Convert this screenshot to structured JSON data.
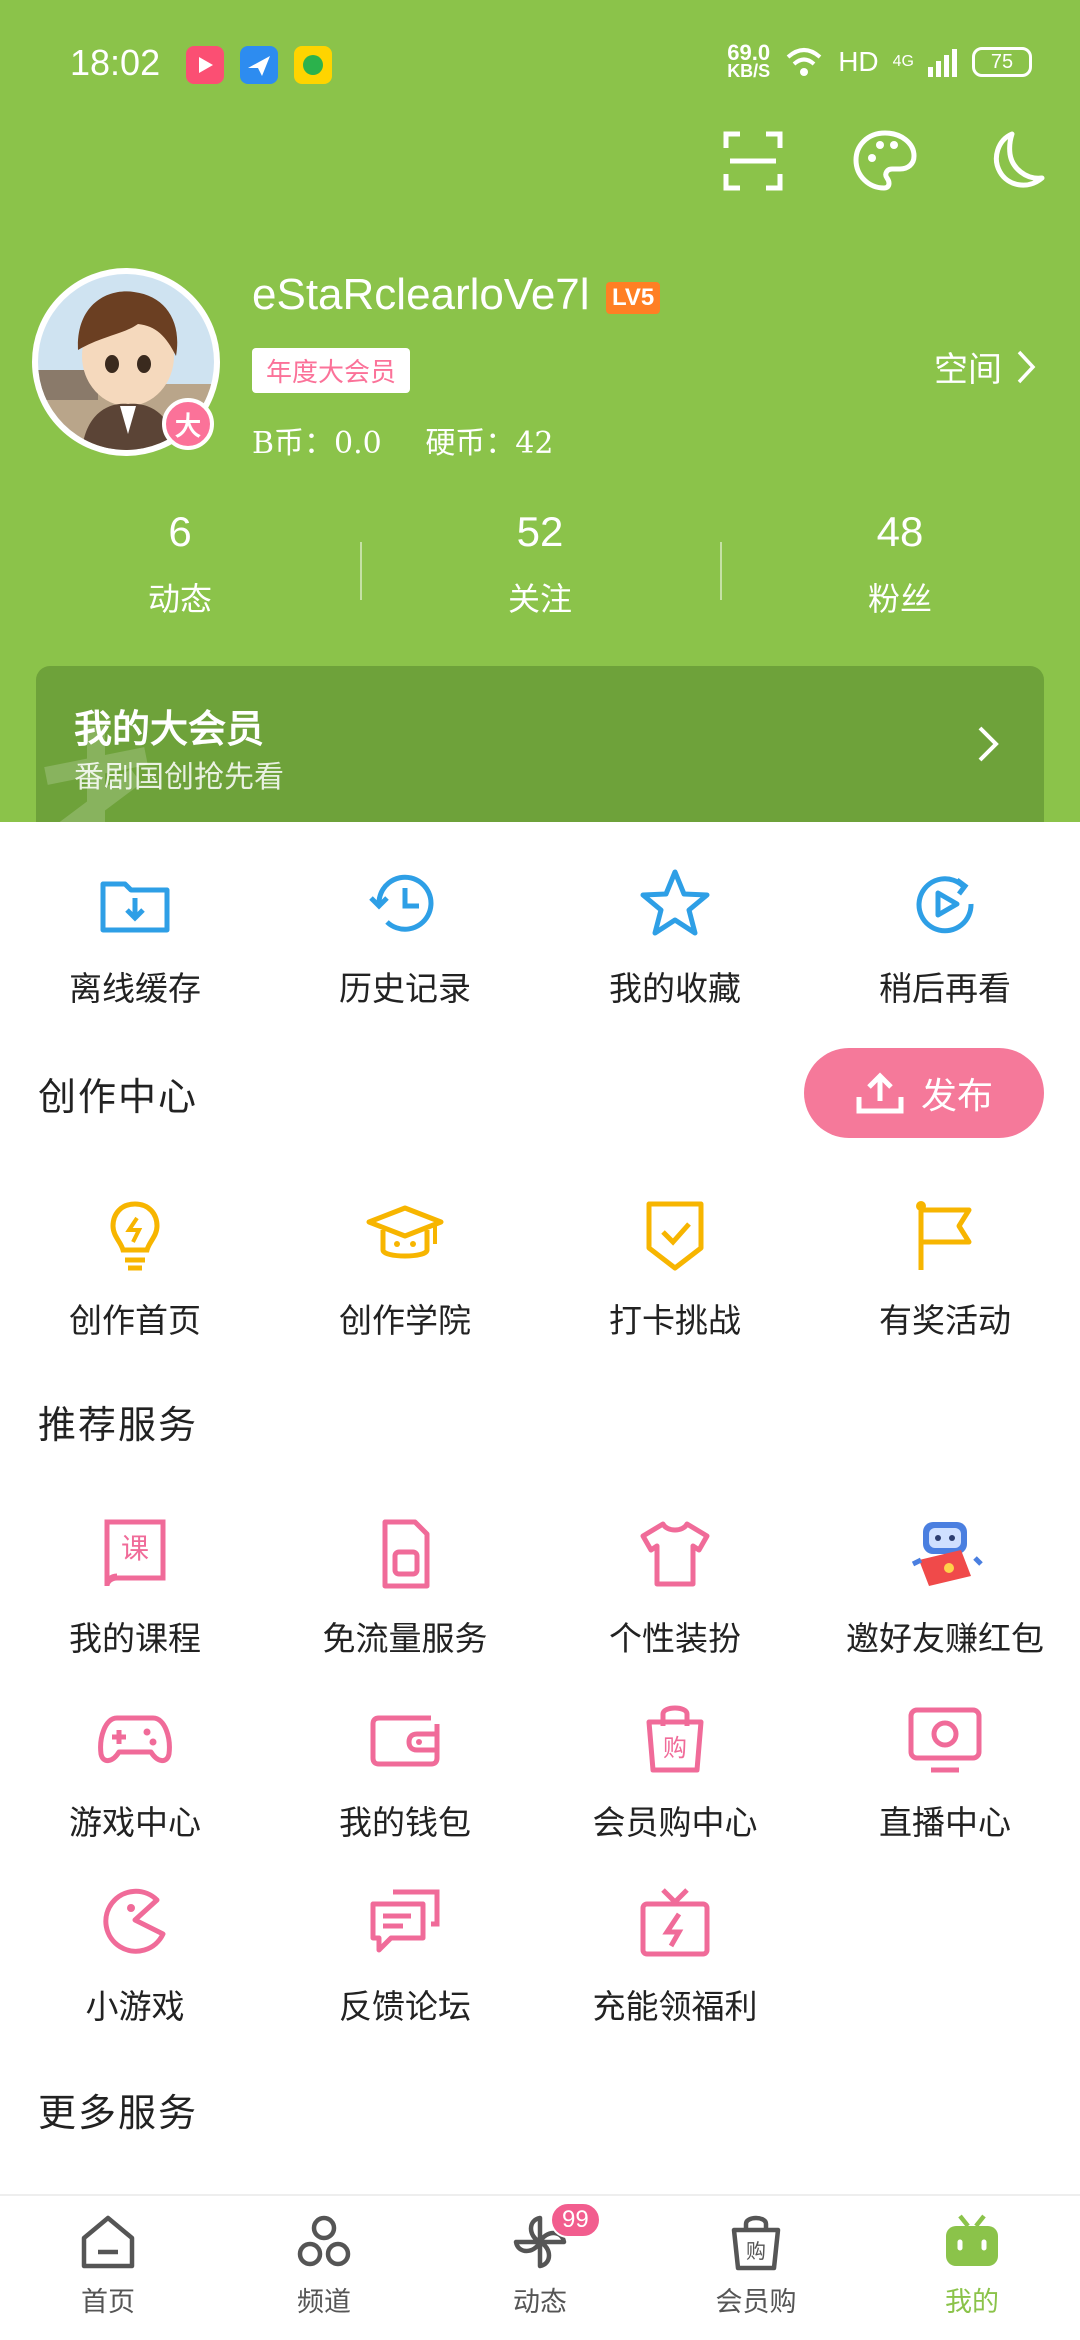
{
  "colors": {
    "header_bg": "#8bc34a",
    "pink": "#fb7299",
    "blue_icon": "#2e9fe6",
    "yellow_icon": "#f7b500",
    "pink_icon": "#f06b99"
  },
  "status_bar": {
    "time": "18:02",
    "net_speed": "69.0",
    "net_unit": "KB/S",
    "hd": "HD",
    "signal": "4G",
    "battery": "75"
  },
  "profile": {
    "username": "eStaRclearloVe7l",
    "level": "LV5",
    "vip_tag": "年度大会员",
    "vip_dot": "大",
    "b_coin": "B币：0.0",
    "coin": "硬币：42",
    "space_label": "空间"
  },
  "stats": [
    {
      "num": "6",
      "label": "动态"
    },
    {
      "num": "52",
      "label": "关注"
    },
    {
      "num": "48",
      "label": "粉丝"
    }
  ],
  "vip_card": {
    "title": "我的大会员",
    "subtitle": "番剧国创抢先看"
  },
  "quick": [
    {
      "label": "离线缓存",
      "icon": "download-folder-icon"
    },
    {
      "label": "历史记录",
      "icon": "history-clock-icon"
    },
    {
      "label": "我的收藏",
      "icon": "star-icon"
    },
    {
      "label": "稍后再看",
      "icon": "watch-later-icon"
    }
  ],
  "creation": {
    "title": "创作中心",
    "publish": "发布",
    "items": [
      {
        "label": "创作首页",
        "icon": "lightbulb-icon"
      },
      {
        "label": "创作学院",
        "icon": "graduation-cap-icon"
      },
      {
        "label": "打卡挑战",
        "icon": "checkin-badge-icon"
      },
      {
        "label": "有奖活动",
        "icon": "flag-icon"
      }
    ]
  },
  "services": {
    "title": "推荐服务",
    "items": [
      {
        "label": "我的课程",
        "icon": "course-book-icon"
      },
      {
        "label": "免流量服务",
        "icon": "sim-card-icon"
      },
      {
        "label": "个性装扮",
        "icon": "tshirt-icon"
      },
      {
        "label": "邀好友赚红包",
        "icon": "mascot-red-envelope-icon"
      },
      {
        "label": "游戏中心",
        "icon": "gamepad-icon"
      },
      {
        "label": "我的钱包",
        "icon": "wallet-icon"
      },
      {
        "label": "会员购中心",
        "icon": "shopping-bag-icon"
      },
      {
        "label": "直播中心",
        "icon": "live-tv-icon"
      },
      {
        "label": "小游戏",
        "icon": "pacman-icon"
      },
      {
        "label": "反馈论坛",
        "icon": "chat-bubbles-icon"
      },
      {
        "label": "充能领福利",
        "icon": "gift-energy-icon"
      }
    ]
  },
  "more_services": {
    "title": "更多服务"
  },
  "tabs": [
    {
      "label": "首页",
      "icon": "home-icon"
    },
    {
      "label": "频道",
      "icon": "channel-icon"
    },
    {
      "label": "动态",
      "icon": "pinwheel-icon",
      "badge": "99"
    },
    {
      "label": "会员购",
      "icon": "shop-bag-icon"
    },
    {
      "label": "我的",
      "icon": "tv-mascot-icon",
      "active": true
    }
  ]
}
